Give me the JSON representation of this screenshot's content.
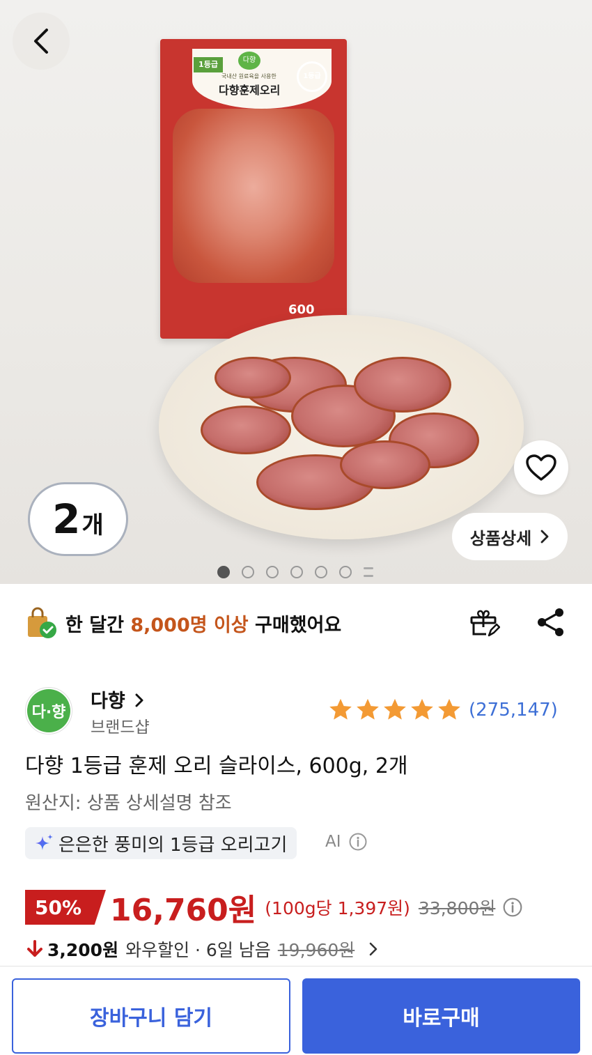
{
  "hero": {
    "package": {
      "grade": "1등급",
      "logo": "다향",
      "sub": "국내산 원료육을 사용한",
      "title": "다향훈제오리",
      "seal": "1등급",
      "weight": "600"
    },
    "quantity_number": "2",
    "quantity_unit": "개",
    "detail_button": "상품상세",
    "dots_total": 6,
    "dots_active_index": 0
  },
  "purchase_banner": {
    "prefix": "한 달간 ",
    "highlight": "8,000명 이상",
    "suffix": " 구매했어요",
    "highlight_color": "#c4551b"
  },
  "brand": {
    "logo_text": "다·향",
    "name": "다향",
    "name_chevron": "❯",
    "sub": "브랜드샵",
    "rating_stars": 5,
    "rating_count": "(275,147)"
  },
  "product": {
    "title": "다향 1등급 훈제 오리 슬라이스, 600g, 2개",
    "origin": "원산지: 상품 상세설명 참조",
    "ai_summary": "은은한 풍미의 1등급 오리고기",
    "ai_label": "AI"
  },
  "price": {
    "discount": "50%",
    "price": "16,760원",
    "unit_price": "(100g당 1,397원)",
    "original_price": "33,800원",
    "wow_amount": "3,200원",
    "wow_text": "와우할인 · 6일 남음",
    "wow_original": "19,960원",
    "accent_color": "#c81e1e"
  },
  "actions": {
    "cart": "장바구니 담기",
    "buy": "바로구매",
    "brand_color": "#3a62dc"
  },
  "icons": [
    "back-icon",
    "heart-icon",
    "chevron-right-icon",
    "shopping-bag-check-icon",
    "gift-icon",
    "share-icon",
    "star-icon",
    "sparkle-icon",
    "info-icon",
    "arrow-down-icon"
  ]
}
